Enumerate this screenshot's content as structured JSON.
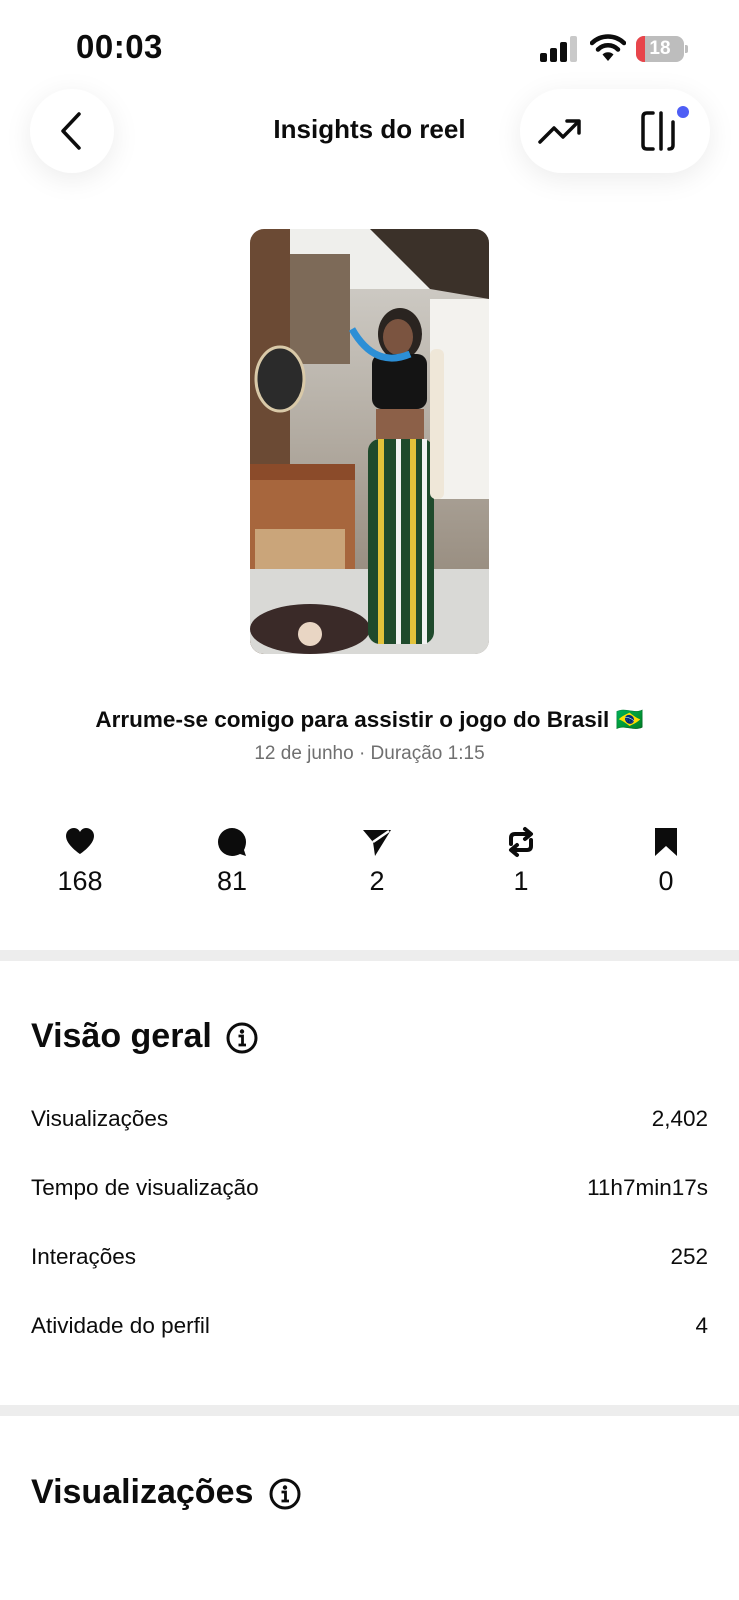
{
  "status_bar": {
    "time": "00:03",
    "battery_level": "18",
    "battery_fraction": 0.18
  },
  "header": {
    "title": "Insights do reel"
  },
  "reel": {
    "title": "Arrume-se comigo para assistir o jogo do Brasil 🇧🇷",
    "meta": "12 de junho · Duração 1:15"
  },
  "engagement": {
    "likes": "168",
    "comments": "81",
    "shares": "2",
    "reposts": "1",
    "saves": "0"
  },
  "overview": {
    "title": "Visão geral",
    "rows": [
      {
        "label": "Visualizações",
        "value": "2,402"
      },
      {
        "label": "Tempo de visualização",
        "value": "11h7min17s"
      },
      {
        "label": "Interações",
        "value": "252"
      },
      {
        "label": "Atividade do perfil",
        "value": "4"
      }
    ]
  },
  "views_section": {
    "title": "Visualizações"
  },
  "colors": {
    "accent_dot": "#4e5ef5",
    "battery_low": "#e8454b",
    "divider": "#ededed"
  }
}
